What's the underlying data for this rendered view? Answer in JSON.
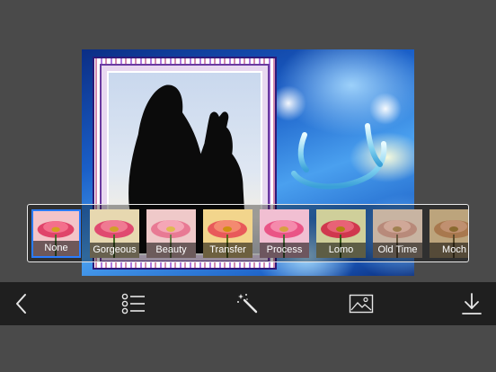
{
  "filters": [
    {
      "label": "None",
      "selected": true,
      "tint": "#f3c4c8"
    },
    {
      "label": "Gorgeous",
      "selected": false,
      "tint": "#e7d8b0"
    },
    {
      "label": "Beauty",
      "selected": false,
      "tint": "#efc9c9"
    },
    {
      "label": "Transfer",
      "selected": false,
      "tint": "#f2d58c"
    },
    {
      "label": "Process",
      "selected": false,
      "tint": "#f1bfd2"
    },
    {
      "label": "Lomo",
      "selected": false,
      "tint": "#cfcf9a"
    },
    {
      "label": "Old Time",
      "selected": false,
      "tint": "#c8b4a2"
    },
    {
      "label": "Moch",
      "selected": false,
      "tint": "#bca47c"
    }
  ],
  "toolbar": {
    "back": "chevron-left-icon",
    "list": "list-icon",
    "effects": "magic-wand-icon",
    "photo": "image-icon",
    "download": "download-icon"
  },
  "colors": {
    "background": "#4a4a4a",
    "toolbar": "#1f1f1f",
    "selection": "#2a7cff"
  }
}
